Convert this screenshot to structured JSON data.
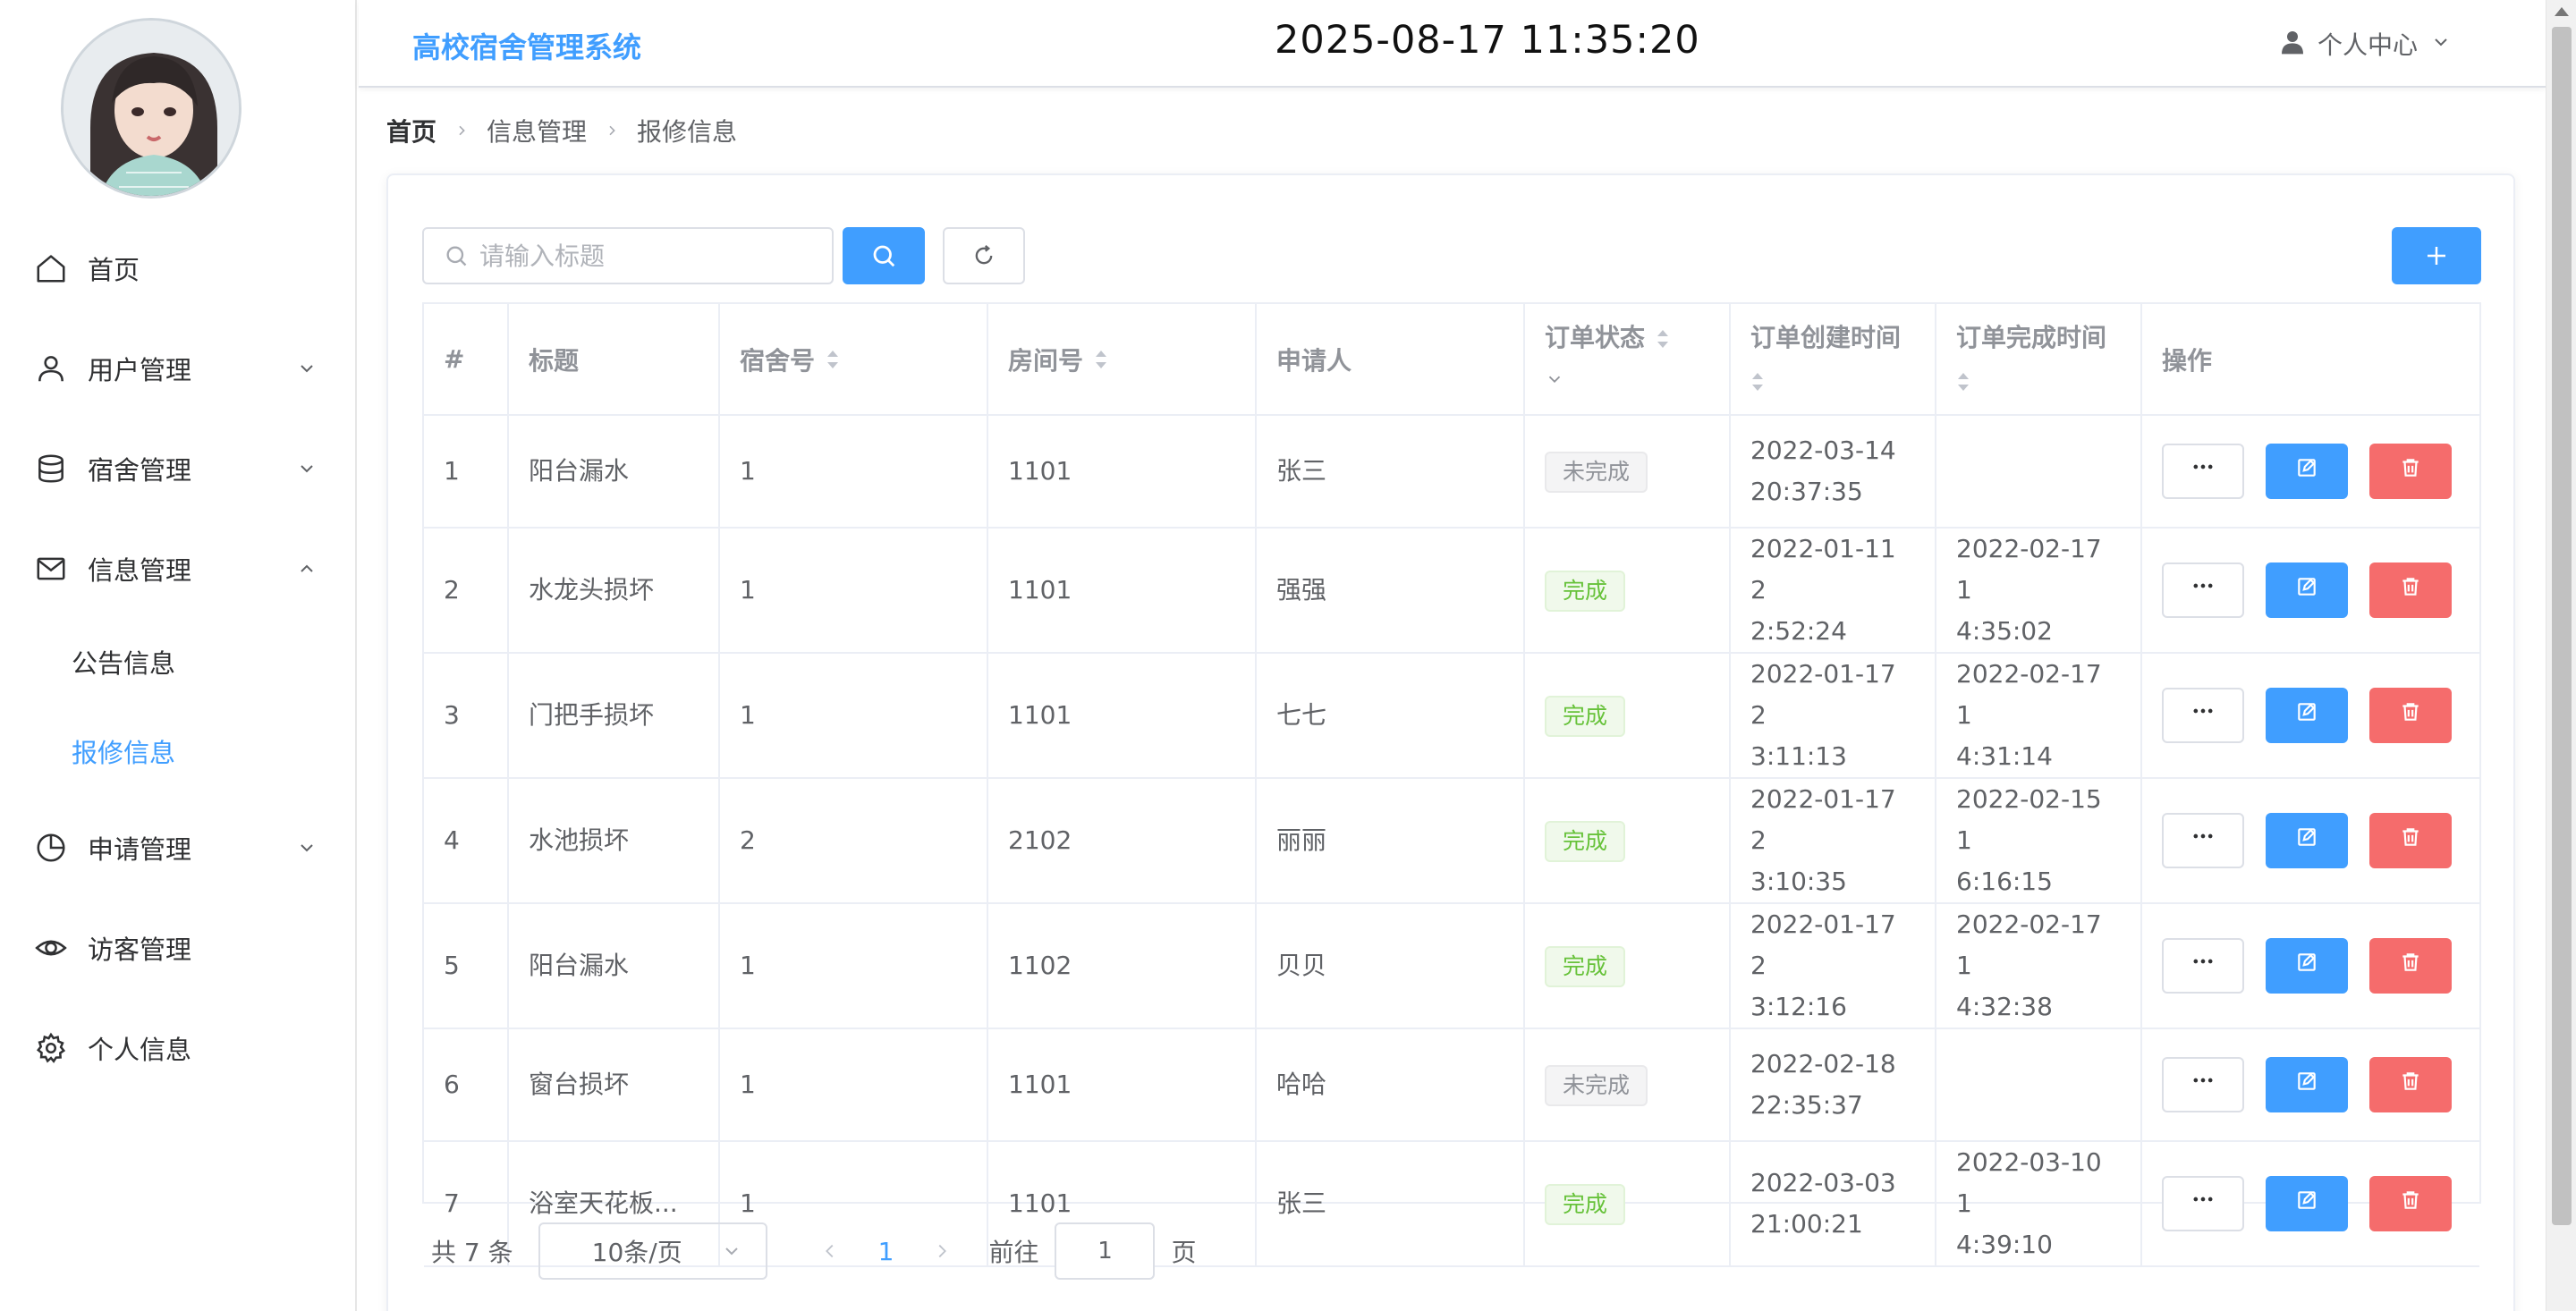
{
  "header": {
    "app_title": "高校宿舍管理系统",
    "datetime": "2025-08-17 11:35:20",
    "user_center_label": "个人中心"
  },
  "sidebar": {
    "avatar_icon": "avatar-photo",
    "items": [
      {
        "label": "首页",
        "icon": "home-icon"
      },
      {
        "label": "用户管理",
        "icon": "user-icon",
        "expandable": true
      },
      {
        "label": "宿舍管理",
        "icon": "database-icon",
        "expandable": true
      },
      {
        "label": "信息管理",
        "icon": "mail-icon",
        "expandable": true,
        "expanded": true
      },
      {
        "label": "申请管理",
        "icon": "pie-chart-icon",
        "expandable": true
      },
      {
        "label": "访客管理",
        "icon": "eye-icon"
      },
      {
        "label": "个人信息",
        "icon": "gear-icon"
      }
    ],
    "submenu": [
      {
        "label": "公告信息",
        "active": false
      },
      {
        "label": "报修信息",
        "active": true
      }
    ],
    "active_color": "#409eff"
  },
  "breadcrumb": [
    "首页",
    "信息管理",
    "报修信息"
  ],
  "toolbar": {
    "search_placeholder": "请输入标题",
    "search_value": "",
    "search_icon": "search-icon",
    "reset_icon": "refresh-icon",
    "add_icon": "plus-icon"
  },
  "table": {
    "columns": [
      "#",
      "标题",
      "宿舍号",
      "房间号",
      "申请人",
      "订单状态",
      "订单创建时间",
      "订单完成时间",
      "操作"
    ],
    "rows": [
      {
        "index": "1",
        "title": "阳台漏水",
        "dorm": "1",
        "room": "1101",
        "applicant": "张三",
        "status": "未完成",
        "created": "2022-03-14\n20:37:35",
        "finished": ""
      },
      {
        "index": "2",
        "title": "水龙头损坏",
        "dorm": "1",
        "room": "1101",
        "applicant": "强强",
        "status": "完成",
        "created": "2022-01-11 2\n2:52:24",
        "finished": "2022-02-17 1\n4:35:02"
      },
      {
        "index": "3",
        "title": "门把手损坏",
        "dorm": "1",
        "room": "1101",
        "applicant": "七七",
        "status": "完成",
        "created": "2022-01-17 2\n3:11:13",
        "finished": "2022-02-17 1\n4:31:14"
      },
      {
        "index": "4",
        "title": "水池损坏",
        "dorm": "2",
        "room": "2102",
        "applicant": "丽丽",
        "status": "完成",
        "created": "2022-01-17 2\n3:10:35",
        "finished": "2022-02-15 1\n6:16:15"
      },
      {
        "index": "5",
        "title": "阳台漏水",
        "dorm": "1",
        "room": "1102",
        "applicant": "贝贝",
        "status": "完成",
        "created": "2022-01-17 2\n3:12:16",
        "finished": "2022-02-17 1\n4:32:38"
      },
      {
        "index": "6",
        "title": "窗台损坏",
        "dorm": "1",
        "room": "1101",
        "applicant": "哈哈",
        "status": "未完成",
        "created": "2022-02-18\n22:35:37",
        "finished": ""
      },
      {
        "index": "7",
        "title": "浴室天花板...",
        "dorm": "1",
        "room": "1101",
        "applicant": "张三",
        "status": "完成",
        "created": "2022-03-03\n21:00:21",
        "finished": "2022-03-10 1\n4:39:10"
      }
    ],
    "status_colors": {
      "完成": "#67c23a",
      "未完成": "#909399"
    },
    "action_icons": [
      "more-icon",
      "edit-icon",
      "delete-icon"
    ]
  },
  "pagination": {
    "total_text": "共 7 条",
    "page_size": "10条/页",
    "current_page": "1",
    "goto_label": "前往",
    "goto_value": "1",
    "page_suffix": "页"
  },
  "colors": {
    "primary": "#409eff",
    "danger": "#f56c6c",
    "success": "#67c23a"
  }
}
